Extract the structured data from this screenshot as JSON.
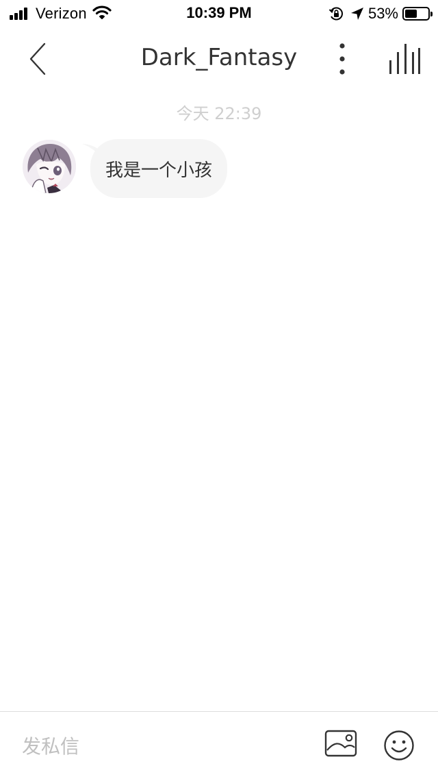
{
  "status_bar": {
    "carrier": "Verizon",
    "time": "10:39 PM",
    "battery_percent": "53%",
    "battery_level": 0.53,
    "icons": [
      "signal-icon",
      "wifi-icon",
      "rotation-lock-icon",
      "location-icon",
      "battery-icon"
    ]
  },
  "header": {
    "title": "Dark_Fantasy",
    "icons": [
      "back-chevron-icon",
      "more-vertical-icon",
      "audio-bars-icon"
    ]
  },
  "chat": {
    "timestamp": "今天 22:39",
    "messages": [
      {
        "sender": "avatar",
        "text": "我是一个小孩"
      }
    ]
  },
  "input_bar": {
    "placeholder": "发私信",
    "icons": [
      "image-icon",
      "emoji-icon"
    ]
  },
  "colors": {
    "bubble_bg": "#f5f5f5",
    "timestamp": "#cfcfcf",
    "placeholder": "#c0c0c0",
    "text": "#333333"
  }
}
